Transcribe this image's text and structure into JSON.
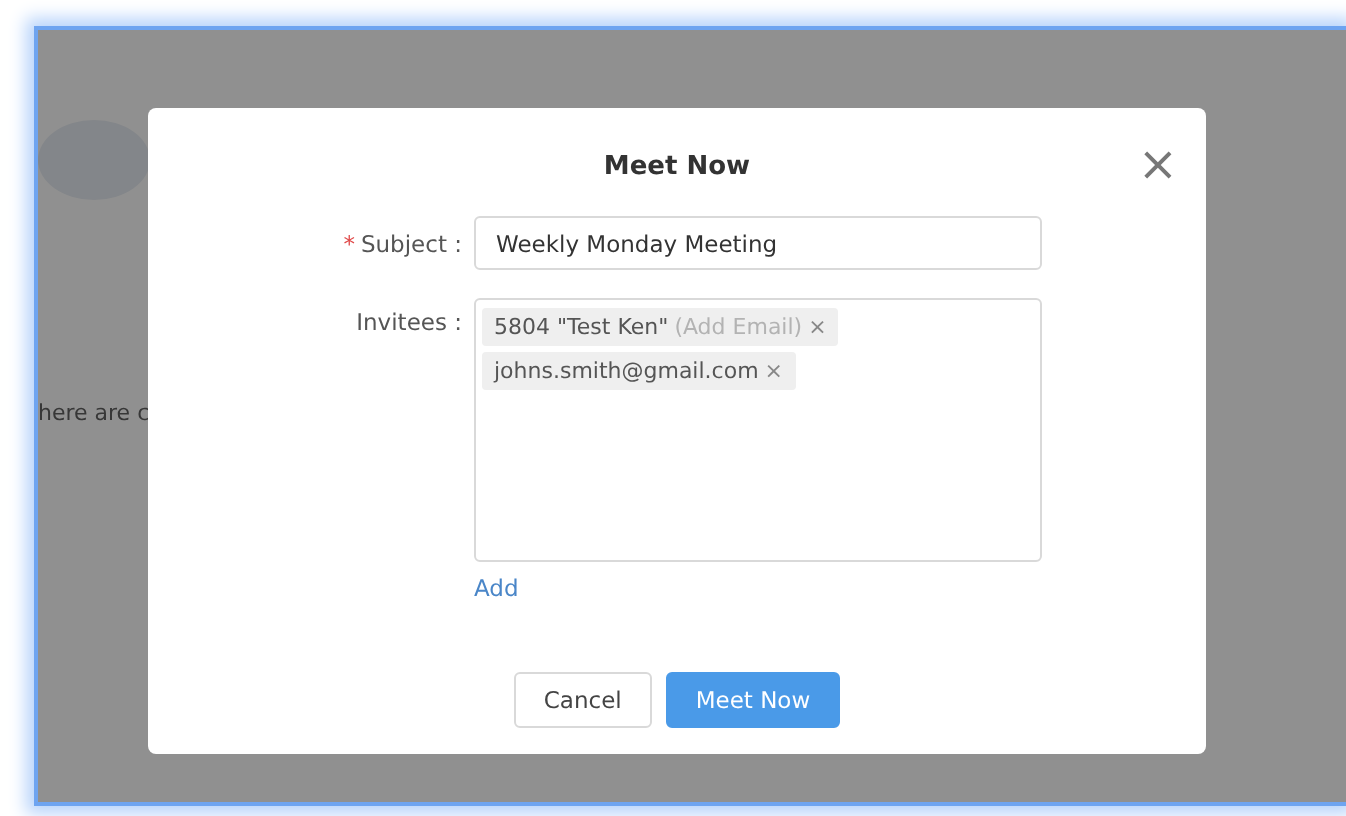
{
  "background": {
    "text": "here are c"
  },
  "dialog": {
    "title": "Meet Now",
    "close": "×",
    "subject": {
      "label": "Subject :",
      "required": true,
      "required_mark": "*",
      "value": "Weekly Monday Meeting"
    },
    "invitees": {
      "label": "Invitees :",
      "tags": [
        {
          "name": "5804 \"Test Ken\"",
          "note": "(Add Email)",
          "remove": "×"
        },
        {
          "name": "johns.smith@gmail.com",
          "remove": "×"
        }
      ]
    },
    "add_link": "Add",
    "buttons": [
      {
        "label": "Cancel",
        "kind": "secondary"
      },
      {
        "label": "Meet Now",
        "kind": "primary"
      }
    ]
  }
}
